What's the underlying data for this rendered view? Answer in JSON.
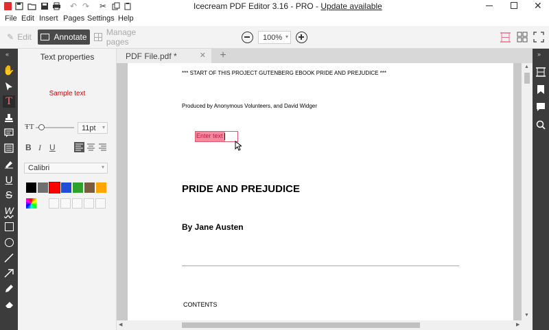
{
  "app": {
    "title": "Icecream PDF Editor 3.16 - PRO - ",
    "update_link": "Update available"
  },
  "menu": {
    "file": "File",
    "edit": "Edit",
    "insert": "Insert",
    "pages": "Pages",
    "settings": "Settings",
    "help": "Help"
  },
  "toolbar": {
    "edit_label": "Edit",
    "annotate_label": "Annotate",
    "manage_pages_label": "Manage pages",
    "zoom_value": "100%"
  },
  "props": {
    "title": "Text properties",
    "sample_text": "Sample text",
    "font_size": "11pt",
    "font_name": "Calibri",
    "colors": [
      "#000000",
      "#6f6f6f",
      "#ff0000",
      "#1e4fd6",
      "#2fa12f",
      "#7a5c3e",
      "#ffa500"
    ]
  },
  "tab": {
    "label": "PDF File.pdf *",
    "add": "+"
  },
  "document": {
    "header_line": "*** START OF THIS PROJECT GUTENBERG EBOOK PRIDE AND PREJUDICE ***",
    "produced_by": "Produced by Anonymous Volunteers, and David Widger",
    "enter_text": "Enter text",
    "title": "PRIDE AND PREJUDICE",
    "author": "By Jane Austen",
    "contents": "CONTENTS"
  }
}
